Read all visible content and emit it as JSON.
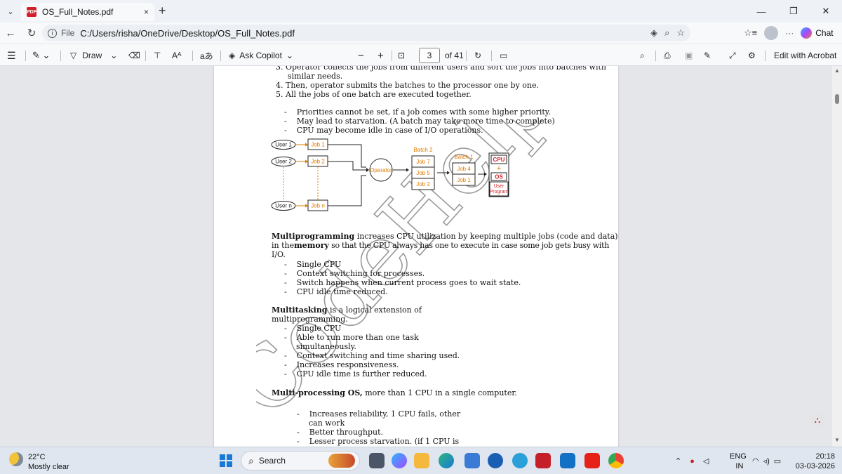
{
  "browser": {
    "tab_title": "OS_Full_Notes.pdf",
    "tab_close": "×",
    "new_tab": "+",
    "address_label": "File",
    "address_url": "C:/Users/risha/OneDrive/Desktop/OS_Full_Notes.pdf",
    "chat_label": "Chat",
    "more": "···"
  },
  "pdf_toolbar": {
    "draw_label": "Draw",
    "copilot_label": "Ask Copilot",
    "zoom_out": "−",
    "zoom_in": "+",
    "current_page": "3",
    "total_pages": "of 41",
    "edit_acrobat": "Edit with Acrobat"
  },
  "document": {
    "lines": [
      {
        "num": "3.",
        "text": "Operator collects the jobs from different users and sort the jobs into batches with"
      },
      {
        "num": "",
        "text": "similar needs."
      },
      {
        "num": "4.",
        "text": "Then, operator submits the batches to the processor one by one."
      },
      {
        "num": "5.",
        "text": "All the jobs of one batch are executed together."
      }
    ],
    "batch_bullets": [
      "Priorities cannot be set, if a job comes with some higher priority.",
      "May lead to starvation. (A batch may take more time to complete)",
      "CPU may become idle in case of I/O operations."
    ],
    "diagram": {
      "users": [
        "User 1",
        "User 2",
        "User n"
      ],
      "jobs": [
        "Job 1",
        "Job 2",
        "Job n"
      ],
      "operator": "Operator",
      "batch2_label": "Batch 2",
      "batch2_jobs": [
        "Job 7",
        "Job 5",
        "Job 2"
      ],
      "batch1_label": "Batch 1",
      "batch1_jobs": [
        "Job 4",
        "Job 1"
      ],
      "cpu": "CPU",
      "plus": "+",
      "os": "OS",
      "user_program": [
        "User",
        "Program"
      ]
    },
    "multiprogramming": {
      "term": "Multiprogramming",
      "line1": " increases CPU utilization by keeping multiple jobs (code and data)",
      "line2_pre": "in the",
      "line2_bold": "memory",
      "line2_post": " so that the CPU always has one to execute in case some job gets busy with",
      "line3": "I/O.",
      "bullets": [
        "Single CPU",
        "Context switching for processes.",
        "Switch happens when current process goes to wait state.",
        "CPU idle time reduced."
      ]
    },
    "multitasking": {
      "term": "Multitasking",
      "line1": " is a logical extension of",
      "line2": "multiprogramming.",
      "bullets": [
        "Single CPU",
        "Able to run more than one task",
        "simultaneously.",
        "Context switching and time sharing used.",
        "Increases responsiveness.",
        "CPU idle time is further reduced."
      ]
    },
    "multiprocessing": {
      "term": "Multi-processing OS,",
      "rest": " more than 1 CPU in a  single computer.",
      "bullets": [
        "Increases reliability, 1 CPU fails, other",
        "can work",
        "Better throughput.",
        "Lesser process starvation. (if 1 CPU is"
      ]
    },
    "watermark": "CodeHelp"
  },
  "taskbar": {
    "temperature": "22°C",
    "weather": "Mostly clear",
    "search_label": "Search",
    "lang1": "ENG",
    "lang2": "IN",
    "time": "20:18",
    "date": "03-03-2026"
  },
  "colors": {
    "accent_orange": "#e07b00",
    "cpu_red": "#d3202a",
    "start_blue": "#1a78d6"
  }
}
